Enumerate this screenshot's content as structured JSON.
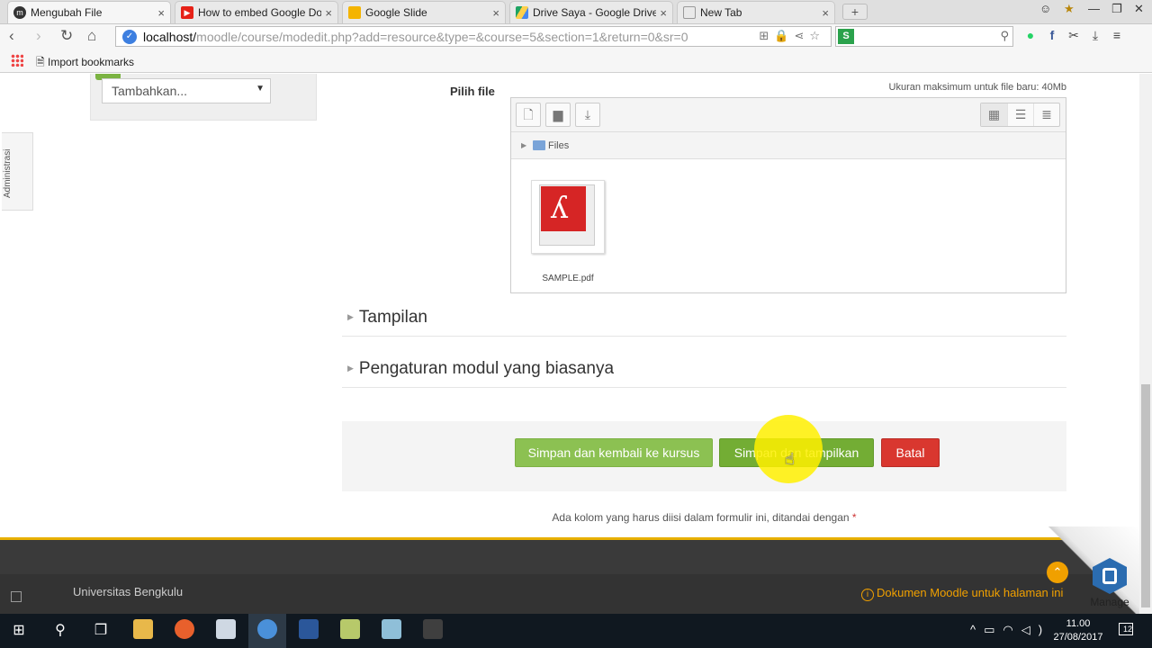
{
  "browser": {
    "tabs": [
      {
        "title": "Mengubah File",
        "icon": "moodle-icon",
        "color": "#333333"
      },
      {
        "title": "How to embed Google Do",
        "icon": "youtube-icon",
        "color": "#e62117"
      },
      {
        "title": "Google Slide",
        "icon": "google-slides-icon",
        "color": "#f4b400"
      },
      {
        "title": "Drive Saya - Google Drive",
        "icon": "google-drive-icon",
        "color": "#1fa463"
      },
      {
        "title": "New Tab",
        "icon": "newtab-icon",
        "color": "#999999"
      }
    ],
    "new_tab_label": "+",
    "url_host": "localhost/",
    "url_path": "moodle/course/modedit.php?add=resource&type=&course=5&section=1&return=0&sr=0",
    "bookmark": "Import bookmarks"
  },
  "sidebar": {
    "add_block_select": "Tambahkan...",
    "admin_tab": "Administrasi"
  },
  "form": {
    "file_label": "Pilih file",
    "max_size": "Ukuran maksimum untuk file baru: 40Mb",
    "path_label": "Files",
    "file_name": "SAMPLE.pdf",
    "sections": [
      "Tampilan",
      "Pengaturan modul yang biasanya"
    ],
    "buttons": {
      "save_return": "Simpan dan kembali ke kursus",
      "save_display": "Simpan dan tampilkan",
      "cancel": "Batal"
    },
    "required_note": "Ada kolom yang harus diisi dalam formulir ini, ditandai dengan",
    "required_star": "*"
  },
  "footer": {
    "site_name": "Universitas Bengkulu",
    "doc_link": "Dokumen Moodle untuk halaman ini",
    "manage": "Manage"
  },
  "taskbar": {
    "time": "11.00",
    "date": "27/08/2017",
    "notifications": "12"
  }
}
